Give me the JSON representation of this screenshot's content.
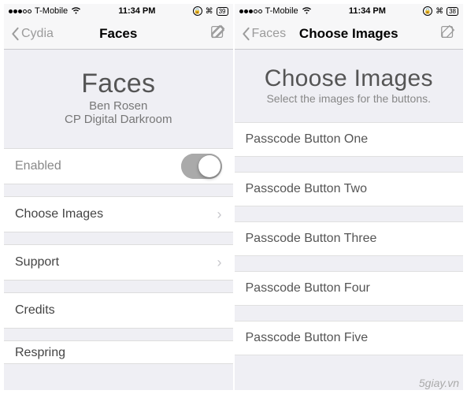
{
  "watermark": "5giay.vn",
  "left": {
    "status": {
      "carrier": "T-Mobile",
      "time": "11:34 PM",
      "battery": "39"
    },
    "nav": {
      "back": "Cydia",
      "title": "Faces"
    },
    "hero": {
      "title": "Faces",
      "line1": "Ben Rosen",
      "line2": "CP Digital Darkroom"
    },
    "rows": {
      "enabled": "Enabled",
      "choose": "Choose Images",
      "support": "Support",
      "credits": "Credits",
      "respring": "Respring"
    }
  },
  "right": {
    "status": {
      "carrier": "T-Mobile",
      "time": "11:34 PM",
      "battery": "38"
    },
    "nav": {
      "back": "Faces",
      "title": "Choose Images"
    },
    "hero": {
      "title": "Choose Images",
      "sub": "Select the images for the buttons."
    },
    "rows": {
      "b1": "Passcode Button One",
      "b2": "Passcode Button Two",
      "b3": "Passcode Button Three",
      "b4": "Passcode Button Four",
      "b5": "Passcode Button Five"
    }
  }
}
